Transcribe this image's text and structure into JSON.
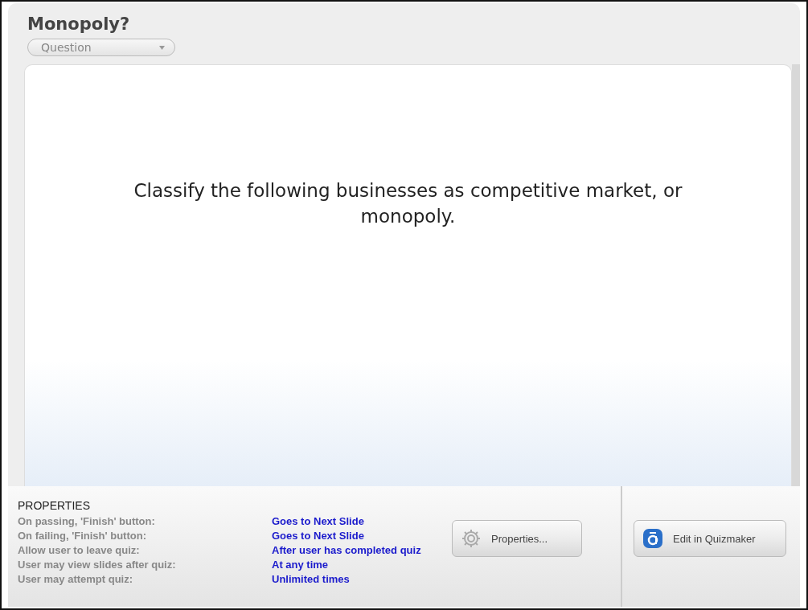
{
  "title": "Monopoly?",
  "slide_type": {
    "value": "Question"
  },
  "question": "Classify the following businesses as competitive market, or monopoly.",
  "properties": {
    "heading": "PROPERTIES",
    "rows": [
      {
        "label": "On passing, 'Finish' button:",
        "value": "Goes to Next Slide"
      },
      {
        "label": "On failing, 'Finish' button:",
        "value": "Goes to Next Slide"
      },
      {
        "label": "Allow user to leave quiz:",
        "value": "After user has completed quiz"
      },
      {
        "label": "User may view slides after quiz:",
        "value": "At any time"
      },
      {
        "label": "User may attempt quiz:",
        "value": "Unlimited times"
      }
    ]
  },
  "buttons": [
    {
      "kind": "properties",
      "label": "Properties..."
    },
    {
      "kind": "edit",
      "label": "Edit in Quizmaker"
    }
  ]
}
